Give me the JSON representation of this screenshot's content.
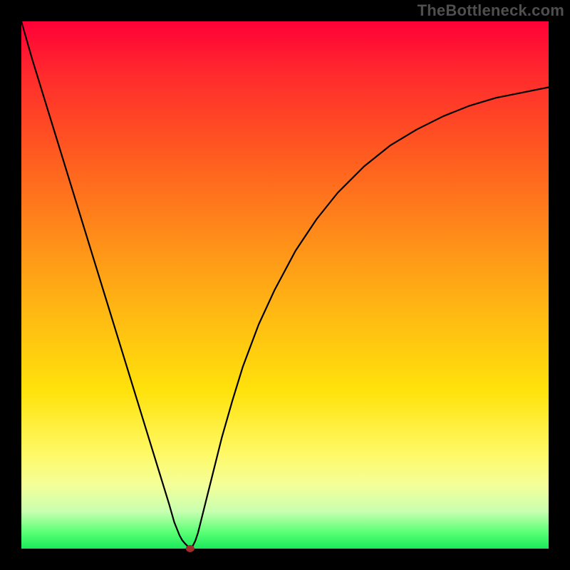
{
  "watermark": "TheBottleneck.com",
  "colors": {
    "background": "#000000",
    "gradient": [
      "#ff0037",
      "#ff2a2d",
      "#ff5a20",
      "#ff8a1a",
      "#ffb813",
      "#ffe20b",
      "#fff966",
      "#f4ff9a",
      "#c7ffb0",
      "#57ff73",
      "#19e85b"
    ],
    "curve_stroke": "#000000",
    "marker_fill": "#a22b2b"
  },
  "chart_data": {
    "type": "line",
    "title": "",
    "xlabel": "",
    "ylabel": "",
    "xlim": [
      0,
      100
    ],
    "ylim": [
      0,
      100
    ],
    "grid": false,
    "marker": {
      "x": 32,
      "y": 0
    },
    "x": [
      0,
      2,
      4,
      6,
      8,
      10,
      12,
      14,
      16,
      18,
      20,
      22,
      24,
      26,
      28,
      29,
      30,
      30.5,
      31,
      31.5,
      32,
      32.5,
      33,
      33.5,
      34,
      35,
      36,
      38,
      40,
      42,
      45,
      48,
      52,
      56,
      60,
      65,
      70,
      75,
      80,
      85,
      90,
      95,
      100
    ],
    "values": [
      100,
      93,
      86.5,
      80,
      73.5,
      67,
      60.5,
      54,
      47.5,
      41,
      34.5,
      28,
      21.5,
      15,
      8.5,
      5,
      2.5,
      1.6,
      1,
      0.5,
      0,
      0.5,
      1.5,
      3,
      5,
      9,
      13,
      21,
      28,
      34.5,
      42.5,
      49,
      56.5,
      62.5,
      67.5,
      72.5,
      76.5,
      79.5,
      82,
      84,
      85.5,
      86.5,
      87.5
    ]
  }
}
